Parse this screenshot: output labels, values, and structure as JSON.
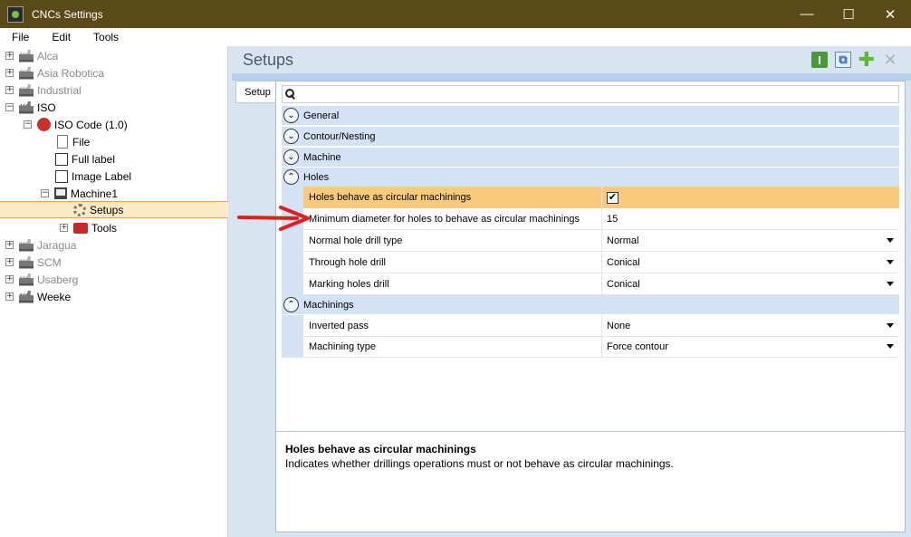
{
  "window": {
    "title": "CNCs Settings",
    "minimize": "—",
    "maximize": "☐",
    "close": "✕"
  },
  "menu": [
    "File",
    "Edit",
    "Tools"
  ],
  "tree": {
    "items": [
      {
        "label": "Alca",
        "expander": "+",
        "icon": "factory-icon",
        "muted": true
      },
      {
        "label": "Asia Robotica",
        "expander": "+",
        "icon": "factory-icon",
        "muted": true
      },
      {
        "label": "Industrial",
        "expander": "+",
        "icon": "factory-icon",
        "muted": true
      },
      {
        "label": "ISO",
        "expander": "−",
        "icon": "factory-icon",
        "muted": false
      },
      {
        "label": "ISO Code (1.0)",
        "expander": "−",
        "icon": "iso-code-icon"
      },
      {
        "label": "File",
        "icon": "file-icon"
      },
      {
        "label": "Full label",
        "icon": "label-icon"
      },
      {
        "label": "Image Label",
        "icon": "image-label-icon"
      },
      {
        "label": "Machine1",
        "expander": "−",
        "icon": "machine-icon"
      },
      {
        "label": "Setups",
        "icon": "gear-icon",
        "selected": true
      },
      {
        "label": "Tools",
        "expander": "+",
        "icon": "toolbox-icon"
      },
      {
        "label": "Jaragua",
        "expander": "+",
        "icon": "factory-icon",
        "muted": true
      },
      {
        "label": "SCM",
        "expander": "+",
        "icon": "factory-icon",
        "muted": true
      },
      {
        "label": "Usaberg",
        "expander": "+",
        "icon": "factory-icon",
        "muted": true
      },
      {
        "label": "Weeke",
        "expander": "+",
        "icon": "factory-icon",
        "muted": false
      }
    ]
  },
  "main": {
    "title": "Setups",
    "tab": "Setup",
    "toolbar": {
      "info": "I",
      "add": "✚",
      "remove": "✕"
    },
    "categories": {
      "general": "General",
      "contour": "Contour/Nesting",
      "machine": "Machine",
      "holes": "Holes",
      "machinings": "Machinings"
    },
    "holes": [
      {
        "name": "Holes behave as circular machinings",
        "value": "✔"
      },
      {
        "name": "Minimum diameter for holes to behave as circular machinings",
        "value": "15"
      },
      {
        "name": "Normal hole drill type",
        "value": "Normal"
      },
      {
        "name": "Through hole drill",
        "value": "Conical"
      },
      {
        "name": "Marking holes drill",
        "value": "Conical"
      }
    ],
    "machinings": [
      {
        "name": "Inverted pass",
        "value": "None"
      },
      {
        "name": "Machining type",
        "value": "Force contour"
      }
    ],
    "description": {
      "title": "Holes behave as circular machinings",
      "text": "Indicates whether drillings operations must or not behave as circular machinings."
    }
  },
  "colors": {
    "titlebar": "#5a4a18",
    "selection": "#fce9c6",
    "highlight_row": "#f9c97c",
    "category_bg": "#d3e2f5",
    "arrow": "#e01e1e"
  }
}
